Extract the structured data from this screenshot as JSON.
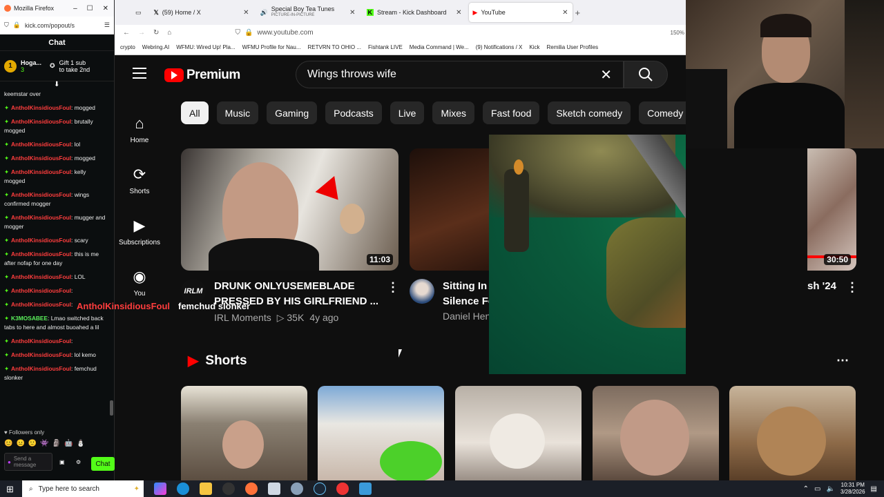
{
  "chat_window": {
    "title": "Mozilla Firefox",
    "url": "kick.com/popout/s",
    "header": "Chat",
    "pinned": {
      "badge": "1",
      "user": "Hoga...",
      "count": "3",
      "gift_text": "Gift 1 sub to take 2nd"
    },
    "messages": [
      {
        "user": "",
        "text": "keemstar over"
      },
      {
        "user": "AntholKinsidiousFoul",
        "text": "mogged"
      },
      {
        "user": "AntholKinsidiousFoul",
        "text": "brutally mogged"
      },
      {
        "user": "AntholKinsidiousFoul",
        "text": "lol"
      },
      {
        "user": "AntholKinsidiousFoul",
        "text": "mogged"
      },
      {
        "user": "AntholKinsidiousFoul",
        "text": "kelly mogged"
      },
      {
        "user": "AntholKinsidiousFoul",
        "text": "wings confirmed mogger"
      },
      {
        "user": "AntholKinsidiousFoul",
        "text": "mugger and mogger"
      },
      {
        "user": "AntholKinsidiousFoul",
        "text": "scary"
      },
      {
        "user": "AntholKinsidiousFoul",
        "text": "this is me after nofap for one day"
      },
      {
        "user": "AntholKinsidiousFoul",
        "text": "LOL"
      },
      {
        "user": "AntholKinsidiousFoul",
        "text": ""
      },
      {
        "user": "AntholKinsidiousFoul",
        "text": ""
      },
      {
        "user": "K3MOSABEE",
        "text": "Lmao switched back tabs to here and almost buoahed a lil",
        "green": true
      },
      {
        "user": "AntholKinsidiousFoul",
        "text": ""
      },
      {
        "user": "AntholKinsidiousFoul",
        "text": "lol kemo"
      },
      {
        "user": "AntholKinsidiousFoul",
        "text": "femchud slonker"
      }
    ],
    "followers_only": "Followers only",
    "send_placeholder": "Send a message",
    "chat_button": "Chat"
  },
  "browser": {
    "tabs": [
      {
        "label": "(59) Home / X"
      },
      {
        "label": "Special Boy Tea Tunes",
        "sub": "PICTURE-IN-PICTURE"
      },
      {
        "label": "Stream - Kick Dashboard"
      },
      {
        "label": "YouTube",
        "active": true
      }
    ],
    "url": "www.youtube.com",
    "zoom": "150%",
    "bookmarks": [
      "crypto",
      "Webring.AI",
      "WFMU: Wired Up! Pla...",
      "WFMU Profile for Nau...",
      "RETVRN TO OHIO ...",
      "Fishtank LIVE",
      "Media Command | We...",
      "(9) Notifications / X",
      "Kick",
      "Remilia User Profiles"
    ]
  },
  "youtube": {
    "logo_text": "Premium",
    "search_query": "Wings throws wife",
    "chips": [
      "All",
      "Music",
      "Gaming",
      "Podcasts",
      "Live",
      "Mixes",
      "Fast food",
      "Sketch comedy",
      "Comedy"
    ],
    "sidebar": [
      {
        "label": "Home",
        "icon": "home-icon"
      },
      {
        "label": "Shorts",
        "icon": "shorts-icon"
      },
      {
        "label": "Subscriptions",
        "icon": "subscriptions-icon"
      },
      {
        "label": "You",
        "icon": "you-icon"
      }
    ],
    "videos": [
      {
        "title": "DRUNK ONLYUSEMEBLADE PRESSED BY HIS GIRLFRIEND ...",
        "channel": "IRL Moments",
        "views": "35K",
        "age": "4y ago",
        "duration": "11:03",
        "avatar_text": "IRLM"
      },
      {
        "title_line1": "Sitting In",
        "title_line2": "Silence Fo",
        "channel": "Daniel Hen"
      },
      {
        "title_fragment": "sh '24",
        "duration": "30:50"
      }
    ],
    "shorts_heading": "Shorts"
  },
  "overlay_names": {
    "left": "AntholKinsidiousFoul",
    "right": "femchud slonker"
  },
  "taskbar": {
    "search_placeholder": "Type here to search",
    "time": "10:31 PM",
    "date": "3/28/2026"
  },
  "colors": {
    "youtube_red": "#ff0000",
    "kick_green": "#53fc18",
    "chat_user_red": "#ff3d3d"
  }
}
